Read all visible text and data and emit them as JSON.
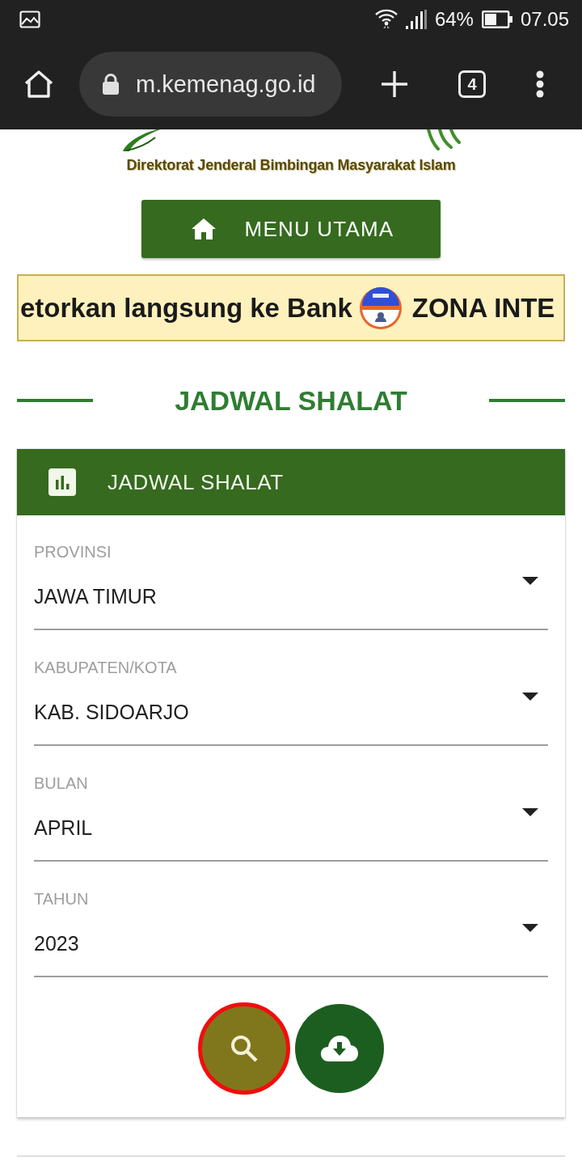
{
  "status_bar": {
    "battery_percent": "64%",
    "time": "07.05"
  },
  "browser": {
    "url": "m.kemenag.go.id",
    "tab_count": "4"
  },
  "header": {
    "org_name": "Direktorat Jenderal Bimbingan Masyarakat Islam",
    "menu_button": "MENU UTAMA"
  },
  "marquee": {
    "items": [
      {
        "kind": "text",
        "text": "etorkan langsung ke Bank"
      },
      {
        "kind": "emblem"
      },
      {
        "kind": "text",
        "text": "ZONA INTE"
      }
    ]
  },
  "section_title": "JADWAL SHALAT",
  "card": {
    "title": "JADWAL SHALAT",
    "fields": [
      {
        "label": "PROVINSI",
        "value": "JAWA TIMUR"
      },
      {
        "label": "KABUPATEN/KOTA",
        "value": "KAB. SIDOARJO"
      },
      {
        "label": "BULAN",
        "value": "APRIL"
      },
      {
        "label": "TAHUN",
        "value": "2023"
      }
    ],
    "actions": [
      {
        "kind": "search",
        "focused": true
      },
      {
        "kind": "download",
        "focused": false
      }
    ]
  }
}
